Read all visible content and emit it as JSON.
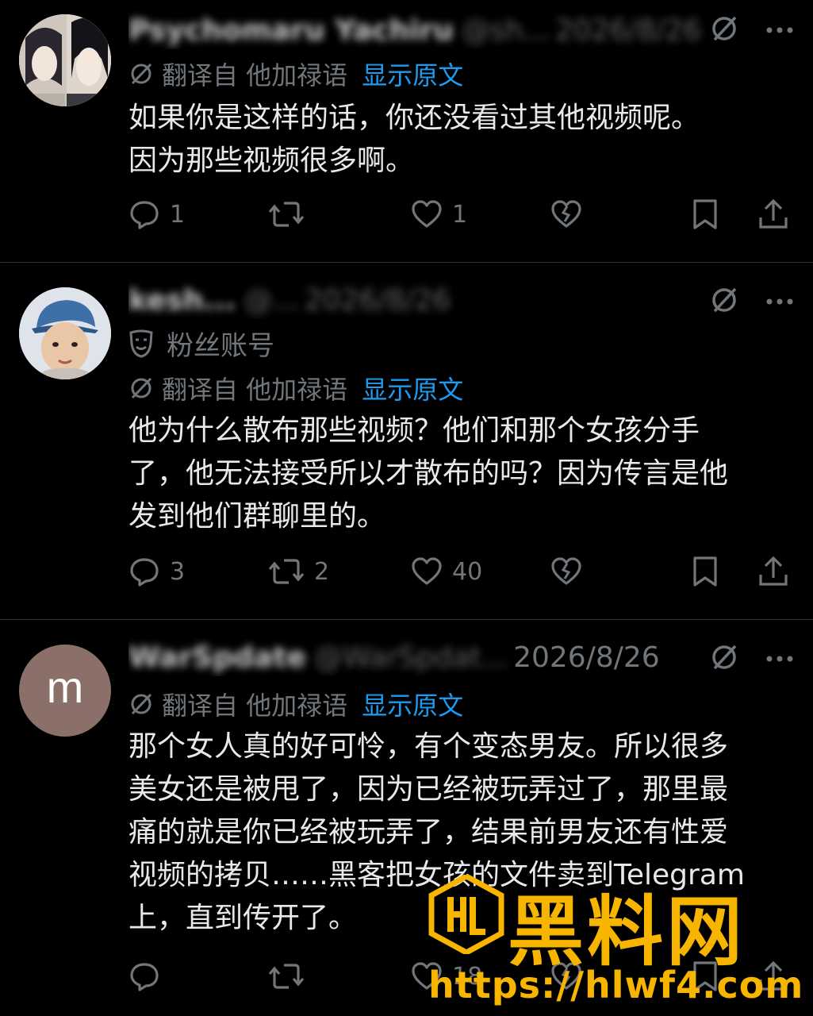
{
  "posts": [
    {
      "author_name": "Psychomaru Yachiru",
      "handle": "@sh...",
      "date": "2026/8/26",
      "translate_label": "翻译自 他加禄语",
      "show_original": "显示原文",
      "body": "如果你是这样的话，你还没看过其他视频呢。\n因为那些视频很多啊。",
      "replies": "1",
      "reposts": "",
      "likes": "1"
    },
    {
      "author_name": "kesh...",
      "handle": "@...",
      "date": "2026/8/26",
      "badge": "粉丝账号",
      "translate_label": "翻译自 他加禄语",
      "show_original": "显示原文",
      "body": "他为什么散布那些视频？他们和那个女孩分手\n了，他无法接受所以才散布的吗？因为传言是他\n发到他们群聊里的。",
      "replies": "3",
      "reposts": "2",
      "likes": "40"
    },
    {
      "author_name": "WarSpdate",
      "handle": "@WarSpdat...",
      "date": "2026/8/26",
      "avatar_letter": "m",
      "translate_label": "翻译自 他加禄语",
      "show_original": "显示原文",
      "body": "那个女人真的好可怜，有个变态男友。所以很多\n美女还是被甩了，因为已经被玩弄过了，那里最\n痛的就是你已经被玩弄了，结果前男友还有性爱\n视频的拷贝……黑客把女孩的文件卖到Telegram\n上，直到传开了。",
      "replies": "",
      "reposts": "",
      "likes": "18"
    }
  ],
  "watermark": {
    "title": "黑料网",
    "url": "https://hlwf4.com"
  },
  "colors": {
    "background": "#000000",
    "text": "#e7e9ea",
    "muted": "#71767b",
    "link": "#1d9bf0",
    "watermark": "#f7b500"
  }
}
